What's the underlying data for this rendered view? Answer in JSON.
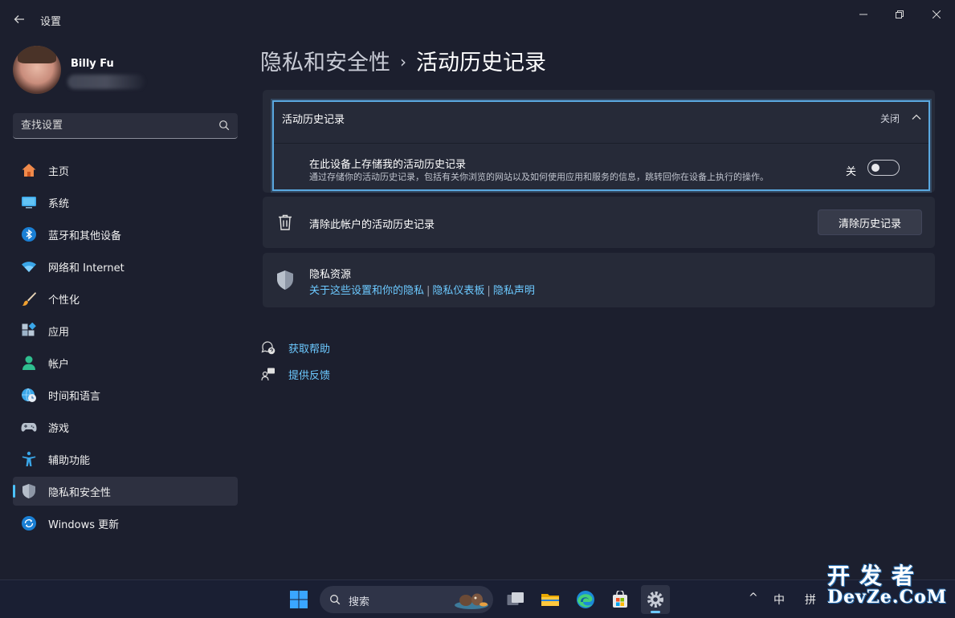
{
  "window": {
    "app_title": "设置"
  },
  "profile": {
    "name": "Billy Fu"
  },
  "search": {
    "placeholder": "查找设置"
  },
  "nav": [
    {
      "label": "主页",
      "icon": "home-icon"
    },
    {
      "label": "系统",
      "icon": "system-display-icon"
    },
    {
      "label": "蓝牙和其他设备",
      "icon": "bluetooth-icon"
    },
    {
      "label": "网络和 Internet",
      "icon": "wifi-icon"
    },
    {
      "label": "个性化",
      "icon": "paintbrush-icon"
    },
    {
      "label": "应用",
      "icon": "apps-icon"
    },
    {
      "label": "帐户",
      "icon": "account-icon"
    },
    {
      "label": "时间和语言",
      "icon": "globe-clock-icon"
    },
    {
      "label": "游戏",
      "icon": "gamepad-icon"
    },
    {
      "label": "辅助功能",
      "icon": "accessibility-icon"
    },
    {
      "label": "隐私和安全性",
      "icon": "shield-icon",
      "active": true
    },
    {
      "label": "Windows 更新",
      "icon": "windows-update-icon"
    }
  ],
  "breadcrumb": {
    "parent": "隐私和安全性",
    "separator": "›",
    "current": "活动历史记录"
  },
  "activity_history": {
    "title": "活动历史记录",
    "state": "关闭",
    "store_setting": {
      "title": "在此设备上存储我的活动历史记录",
      "description": "通过存储你的活动历史记录，包括有关你浏览的网站以及如何使用应用和服务的信息，跳转回你在设备上执行的操作。",
      "toggle_label": "关",
      "toggle_on": false
    }
  },
  "clear_history": {
    "label": "清除此帐户的活动历史记录",
    "button": "清除历史记录"
  },
  "privacy_resources": {
    "title": "隐私资源",
    "links": [
      "关于这些设置和你的隐私",
      "隐私仪表板",
      "隐私声明"
    ],
    "link_separator": "|"
  },
  "help": {
    "get_help": "获取帮助",
    "feedback": "提供反馈"
  },
  "taskbar": {
    "search_label": "搜索",
    "tray": {
      "chevron": "^",
      "ime_mode": "中",
      "ime_type": "拼"
    }
  },
  "watermark": {
    "line1": "开发者",
    "line2": "DevZe.CoM"
  },
  "colors": {
    "accent": "#4cc2ff",
    "link": "#6cc9ff",
    "background": "#1c1f2e",
    "card": "#262a38",
    "focus_ring": "#5aa8e0"
  }
}
